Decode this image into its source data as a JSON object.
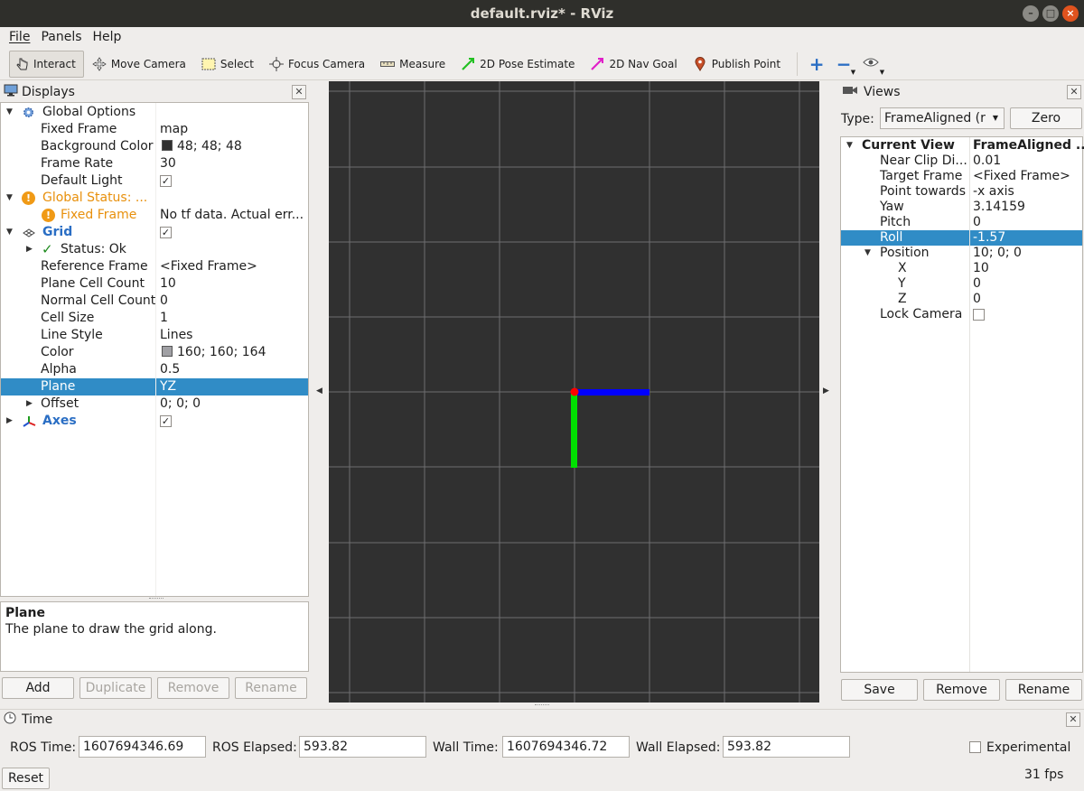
{
  "window": {
    "title": "default.rviz* - RViz"
  },
  "menu": {
    "file": "File",
    "panels": "Panels",
    "help": "Help"
  },
  "toolbar": {
    "interact": "Interact",
    "move_camera": "Move Camera",
    "select": "Select",
    "focus_camera": "Focus Camera",
    "measure": "Measure",
    "pose_estimate": "2D Pose Estimate",
    "nav_goal": "2D Nav Goal",
    "publish_point": "Publish Point"
  },
  "displays": {
    "title": "Displays",
    "rows": [
      {
        "name": "Global Options",
        "value": ""
      },
      {
        "name": "Fixed Frame",
        "value": "map"
      },
      {
        "name": "Background Color",
        "value": "48; 48; 48"
      },
      {
        "name": "Frame Rate",
        "value": "30"
      },
      {
        "name": "Default Light",
        "value": ""
      },
      {
        "name": "Global Status: ...",
        "value": ""
      },
      {
        "name": "Fixed Frame",
        "value": "No tf data.  Actual err..."
      },
      {
        "name": "Grid",
        "value": ""
      },
      {
        "name": "Status: Ok",
        "value": ""
      },
      {
        "name": "Reference Frame",
        "value": "<Fixed Frame>"
      },
      {
        "name": "Plane Cell Count",
        "value": "10"
      },
      {
        "name": "Normal Cell Count",
        "value": "0"
      },
      {
        "name": "Cell Size",
        "value": "1"
      },
      {
        "name": "Line Style",
        "value": "Lines"
      },
      {
        "name": "Color",
        "value": "160; 160; 164"
      },
      {
        "name": "Alpha",
        "value": "0.5"
      },
      {
        "name": "Plane",
        "value": "YZ"
      },
      {
        "name": "Offset",
        "value": "0; 0; 0"
      },
      {
        "name": "Axes",
        "value": ""
      }
    ],
    "description_title": "Plane",
    "description_text": "The plane to draw the grid along.",
    "buttons": {
      "add": "Add",
      "duplicate": "Duplicate",
      "remove": "Remove",
      "rename": "Rename"
    }
  },
  "views": {
    "title": "Views",
    "type_label": "Type:",
    "type_value": "FrameAligned (r",
    "zero": "Zero",
    "rows": [
      {
        "name": "Current View",
        "value": "FrameAligned ..."
      },
      {
        "name": "Near Clip Di...",
        "value": "0.01"
      },
      {
        "name": "Target Frame",
        "value": "<Fixed Frame>"
      },
      {
        "name": "Point towards",
        "value": "-x axis"
      },
      {
        "name": "Yaw",
        "value": "3.14159"
      },
      {
        "name": "Pitch",
        "value": "0"
      },
      {
        "name": "Roll",
        "value": "-1.57"
      },
      {
        "name": "Position",
        "value": "10; 0; 0"
      },
      {
        "name": "X",
        "value": "10"
      },
      {
        "name": "Y",
        "value": "0"
      },
      {
        "name": "Z",
        "value": "0"
      },
      {
        "name": "Lock Camera",
        "value": ""
      }
    ],
    "buttons": {
      "save": "Save",
      "remove": "Remove",
      "rename": "Rename"
    }
  },
  "time": {
    "title": "Time",
    "ros_time_label": "ROS Time:",
    "ros_time": "1607694346.69",
    "ros_elapsed_label": "ROS Elapsed:",
    "ros_elapsed": "593.82",
    "wall_time_label": "Wall Time:",
    "wall_time": "1607694346.72",
    "wall_elapsed_label": "Wall Elapsed:",
    "wall_elapsed": "593.82",
    "experimental": "Experimental",
    "reset": "Reset",
    "fps": "31 fps"
  },
  "colors": {
    "background": "#303030",
    "grid_color": "#a0a0a4",
    "selection": "#308cc6",
    "warning": "#e8900c",
    "link_blue": "#2a6ec4"
  }
}
